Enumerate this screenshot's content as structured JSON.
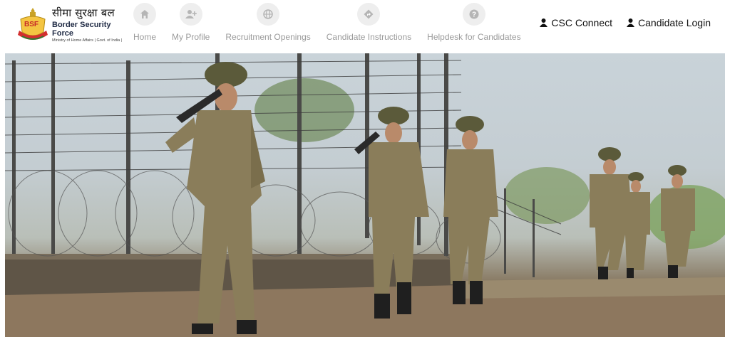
{
  "brand": {
    "hindi_name": "सीमा सुरक्षा बल",
    "english_name": "Border Security Force",
    "ministry": "Ministry of Home Affairs | Govt. of India |",
    "badge_text": "BSF"
  },
  "nav": {
    "items": [
      {
        "label": "Home",
        "icon": "home-icon"
      },
      {
        "label": "My Profile",
        "icon": "user-plus-icon"
      },
      {
        "label": "Recruitment Openings",
        "icon": "globe-icon"
      },
      {
        "label": "Candidate Instructions",
        "icon": "directions-icon"
      },
      {
        "label": "Helpdesk for Candidates",
        "icon": "question-icon"
      }
    ]
  },
  "header_links": {
    "csc_connect": "CSC Connect",
    "candidate_login": "Candidate Login"
  },
  "hero": {
    "description_icon": "hero-photo"
  },
  "colors": {
    "nav_icon_bg": "#eeeeee",
    "nav_label": "#9a9a9a",
    "brand_red": "#d32f2f",
    "brand_text": "#1f2a44"
  }
}
